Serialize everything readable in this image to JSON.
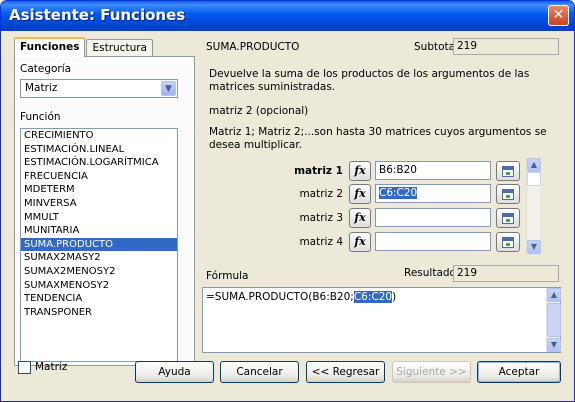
{
  "window": {
    "title": "Asistente: Funciones",
    "close_glyph": "✕"
  },
  "tabs": [
    {
      "label": "Funciones"
    },
    {
      "label": "Estructura"
    }
  ],
  "category": {
    "label": "Categoría",
    "value": "Matriz"
  },
  "function_list": {
    "label": "Función",
    "items": [
      "CRECIMIENTO",
      "ESTIMACIÓN.LINEAL",
      "ESTIMACIÓN.LOGARÍTMICA",
      "FRECUENCIA",
      "MDETERM",
      "MINVERSA",
      "MMULT",
      "MUNITARIA",
      "SUMA.PRODUCTO",
      "SUMAX2MASY2",
      "SUMAX2MENOSY2",
      "SUMAXMENOSY2",
      "TENDENCIA",
      "TRANSPONER"
    ],
    "selected": "SUMA.PRODUCTO"
  },
  "function": {
    "name": "SUMA.PRODUCTO",
    "subtotal_label": "Subtotal",
    "subtotal_value": "219",
    "description": "Devuelve la suma de los productos de los argumentos de las matrices suministradas.",
    "arg_title": "matriz 2 (opcional)",
    "arg_help": "Matriz 1; Matriz 2;...son hasta 30 matrices cuyos argumentos se desea multiplicar."
  },
  "arguments": [
    {
      "label": "matriz 1",
      "value": "B6:B20"
    },
    {
      "label": "matriz 2",
      "value": "C6:C20"
    },
    {
      "label": "matriz 3",
      "value": ""
    },
    {
      "label": "matriz 4",
      "value": ""
    }
  ],
  "fx_glyph": "fx",
  "formula": {
    "label": "Fórmula",
    "result_label": "Resultado",
    "result_value": "219",
    "text_prefix": "=SUMA.PRODUCTO(B6:B20;",
    "text_selected": "C6:C20",
    "text_suffix": ")"
  },
  "buttons": {
    "matrix_label": "Matriz",
    "help": "Ayuda",
    "cancel": "Cancelar",
    "back": "<< Regresar",
    "next": "Siguiente >>",
    "accept": "Aceptar"
  },
  "icons": {
    "close": "close-icon",
    "dropdown": "chevron-down-icon",
    "fx": "fx-icon",
    "shrink": "shrink-dialog-icon"
  },
  "colors": {
    "titlebar": "#0058ee",
    "selection": "#316ac5",
    "dialog_bg": "#ece9d8"
  }
}
